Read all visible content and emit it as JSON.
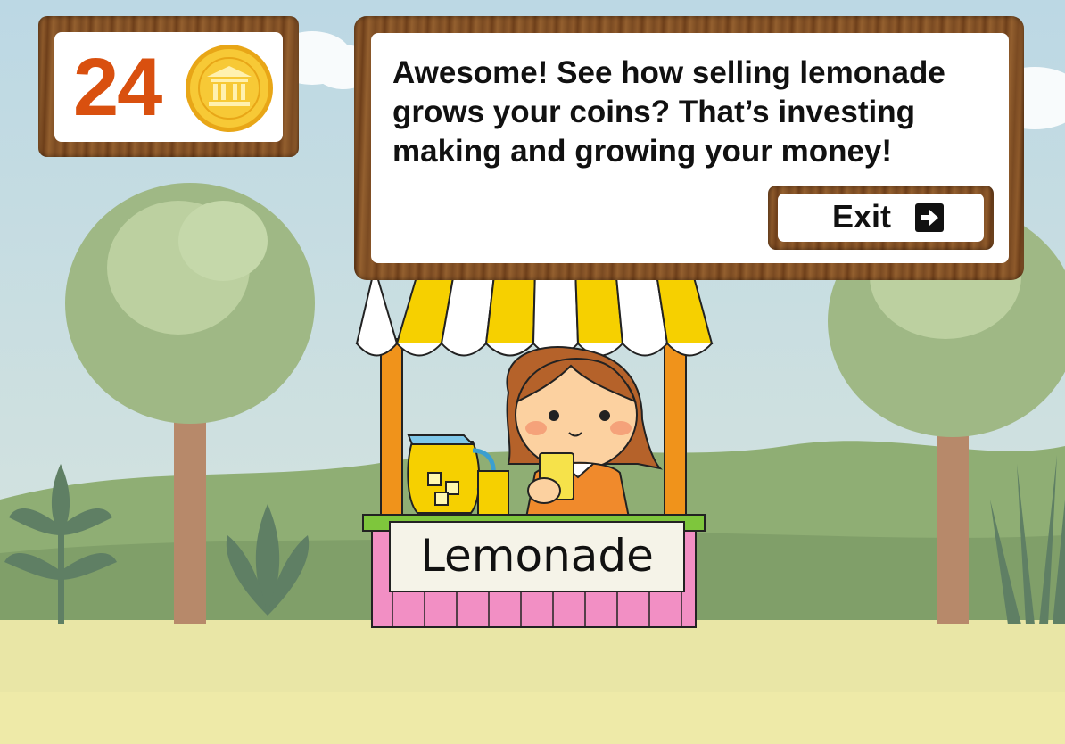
{
  "score": {
    "coins": "24",
    "icon": "bank-coin-icon"
  },
  "dialog": {
    "message": "Awesome! See how selling lemonade grows your coins? That’s investing making and growing your money!",
    "exit_label": "Exit",
    "exit_icon": "exit-arrow-icon"
  },
  "stand": {
    "sign_text": "Lemonade"
  },
  "colors": {
    "coin_count": "#d9500f",
    "wood": "#7a4a22",
    "sky": "#c9dde2",
    "grass": "#e9e6a6",
    "hills": "#8fae74"
  }
}
